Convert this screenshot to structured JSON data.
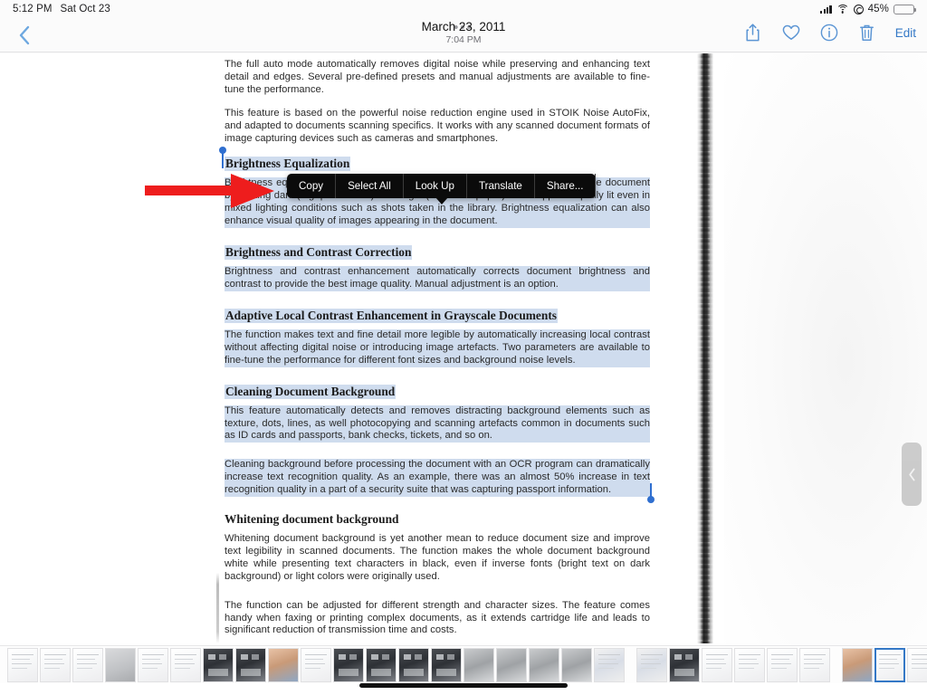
{
  "status_bar": {
    "time": "5:12 PM",
    "date": "Sat Oct 23",
    "battery_percent": "45%",
    "icons": [
      "cellular-signal-icon",
      "wifi-icon",
      "rotation-lock-icon",
      "battery-icon"
    ]
  },
  "nav": {
    "back_label": "chevron-left-icon",
    "grabber": "•••",
    "title": "March 23, 2011",
    "subtitle": "7:04 PM",
    "actions": [
      {
        "name": "share-icon",
        "label": "Share"
      },
      {
        "name": "favorite-heart-icon",
        "label": "Favorite"
      },
      {
        "name": "info-icon",
        "label": "Info"
      },
      {
        "name": "trash-icon",
        "label": "Delete"
      }
    ],
    "edit_label": "Edit",
    "accent_color": "#3478c6"
  },
  "context_menu": {
    "items": [
      "Copy",
      "Select All",
      "Look Up",
      "Translate",
      "Share..."
    ],
    "background": "#0b0b0b",
    "text_color": "#ffffff"
  },
  "annotation": {
    "type": "red-arrow",
    "color": "#ee1d1d",
    "direction": "right",
    "points_at": "context-menu"
  },
  "selection": {
    "highlight_color": "#cfdcee",
    "handle_color": "#2f6fd0",
    "start_text": "Brightness Equalization",
    "end_text": "capturing passport information."
  },
  "document": {
    "blocks": [
      {
        "kind": "para",
        "selected": false,
        "text": "The full auto mode automatically removes digital noise while preserving and enhancing text detail and edges. Several pre-defined presets and manual adjustments are available to fine-tune the performance."
      },
      {
        "kind": "para",
        "selected": false,
        "text": "This feature is based on the powerful noise reduction engine used in STOIK Noise AutoFix, and adapted to documents scanning specifics. It works with any scanned document formats of image capturing devices such as cameras and smartphones."
      },
      {
        "kind": "heading",
        "selected": true,
        "text": "Brightness Equalization"
      },
      {
        "kind": "para",
        "selected": true,
        "text": "Brightness equalization automatically reduces brightness variations throughout the document by making dark (e.g. printed text) and bright (e.g. white paper) areas appear equally lit even in mixed lighting conditions such as shots taken in the library. Brightness equalization can also enhance visual quality of images appearing in the document."
      },
      {
        "kind": "heading",
        "selected": true,
        "text": "Brightness and Contrast Correction"
      },
      {
        "kind": "para",
        "selected": true,
        "text": "Brightness and contrast enhancement automatically corrects document brightness and contrast to provide the best image quality. Manual adjustment is an option."
      },
      {
        "kind": "heading",
        "selected": true,
        "text": "Adaptive Local Contrast Enhancement in Grayscale Documents"
      },
      {
        "kind": "para",
        "selected": true,
        "text": "The function makes text and fine detail more legible by automatically increasing local contrast without affecting digital noise or introducing image artefacts. Two parameters are available to fine-tune the performance for different font sizes and background noise levels."
      },
      {
        "kind": "heading",
        "selected": true,
        "text": "Cleaning Document Background"
      },
      {
        "kind": "para",
        "selected": true,
        "text": "This feature automatically detects and removes distracting background elements such as texture, dots, lines, as well photocopying and scanning artefacts common in documents such as ID cards and passports, bank checks, tickets, and so on."
      },
      {
        "kind": "para",
        "selected": true,
        "text": "Cleaning background before processing the document with an OCR program can dramatically increase text recognition quality. As an example, there was an almost 50% increase in text recognition quality in a part of a security suite that was capturing passport information."
      },
      {
        "kind": "heading",
        "selected": false,
        "text": "Whitening document background"
      },
      {
        "kind": "para",
        "selected": false,
        "text": "Whitening document background is yet another mean to reduce document size and improve text legibility in scanned documents. The function makes the whole document background white while presenting text characters in black, even if inverse fonts (bright text on dark background) or light colors were originally used."
      },
      {
        "kind": "para",
        "selected": false,
        "text": "The function can be adjusted for different strength and character sizes. The feature comes handy when faxing or printing complex documents, as it extends cartridge life and leads to significant reduction of transmission time and costs."
      }
    ]
  },
  "sidebar_tab": {
    "icon": "chevron-left-icon",
    "color": "#c8c8c8"
  },
  "filmstrip": {
    "thumbnails": [
      {
        "style": "doc-light"
      },
      {
        "style": "doc-light"
      },
      {
        "style": "doc-light"
      },
      {
        "style": "doc-gray"
      },
      {
        "style": "doc-light"
      },
      {
        "style": "doc-light"
      },
      {
        "style": "dark-ui"
      },
      {
        "style": "dark-ui"
      },
      {
        "style": "portrait"
      },
      {
        "style": "doc-light"
      },
      {
        "style": "dark-ui"
      },
      {
        "style": "dark-ui"
      },
      {
        "style": "dark-ui"
      },
      {
        "style": "dark-ui"
      },
      {
        "style": "gray-blur"
      },
      {
        "style": "gray-blur"
      },
      {
        "style": "gray-blur"
      },
      {
        "style": "gray-blur"
      },
      {
        "style": "color-grid"
      },
      {
        "style": "color-grid"
      },
      {
        "style": "dark-ui"
      },
      {
        "style": "doc-light"
      },
      {
        "style": "doc-light"
      },
      {
        "style": "doc-light"
      },
      {
        "style": "doc-light"
      },
      {
        "style": "portrait"
      },
      {
        "style": "doc-light"
      },
      {
        "style": "doc-light"
      },
      {
        "style": "doc-light"
      }
    ],
    "selected_index": 26
  }
}
